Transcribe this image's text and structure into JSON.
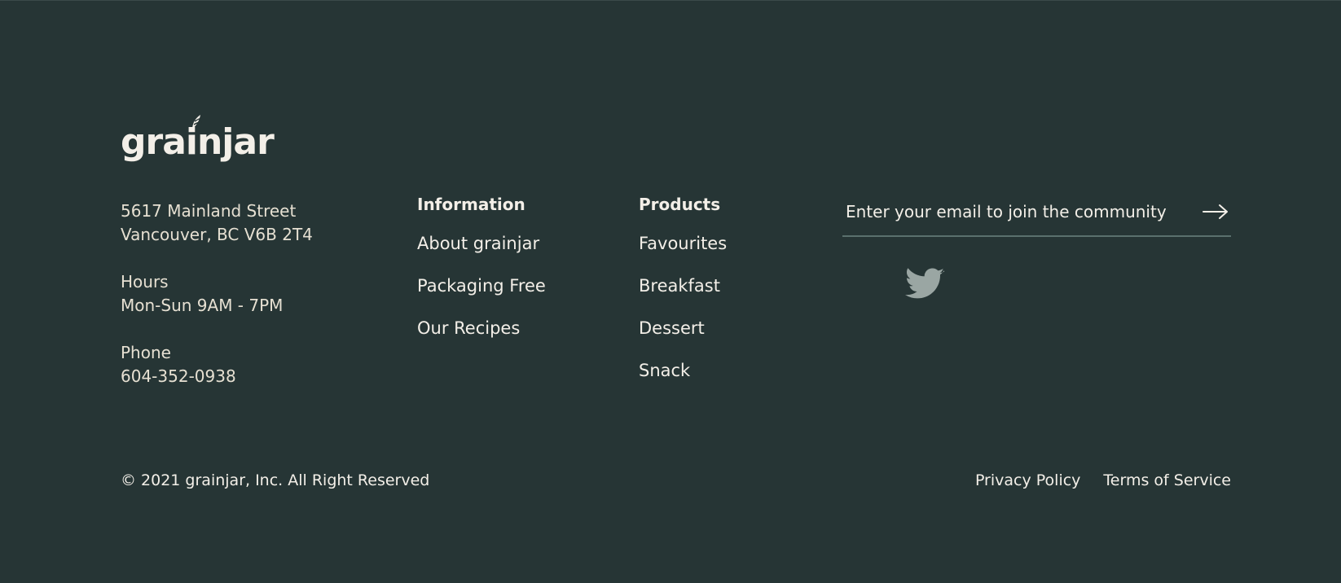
{
  "brand": {
    "name": "grainjar"
  },
  "contact": {
    "address_line1": "5617 Mainland Street",
    "address_line2": "Vancouver, BC  V6B 2T4",
    "hours_label": "Hours",
    "hours_value": "Mon-Sun 9AM - 7PM",
    "phone_label": "Phone",
    "phone_value": "604-352-0938"
  },
  "information": {
    "heading": "Information",
    "links": [
      "About grainjar",
      "Packaging Free",
      "Our Recipes"
    ]
  },
  "products": {
    "heading": "Products",
    "links": [
      "Favourites",
      "Breakfast",
      "Dessert",
      "Snack"
    ]
  },
  "newsletter": {
    "placeholder": "Enter your email to join the community",
    "submit_icon": "arrow-right-icon"
  },
  "social": {
    "icons": [
      "twitter-icon"
    ]
  },
  "bottom": {
    "copyright": "© 2021 grainjar, Inc. All Right Reserved",
    "privacy": "Privacy Policy",
    "terms": "Terms of Service"
  },
  "colors": {
    "background": "#263535",
    "text": "#f3efe8",
    "muted_icon": "#9aa6a3",
    "divider": "#5a706d"
  }
}
